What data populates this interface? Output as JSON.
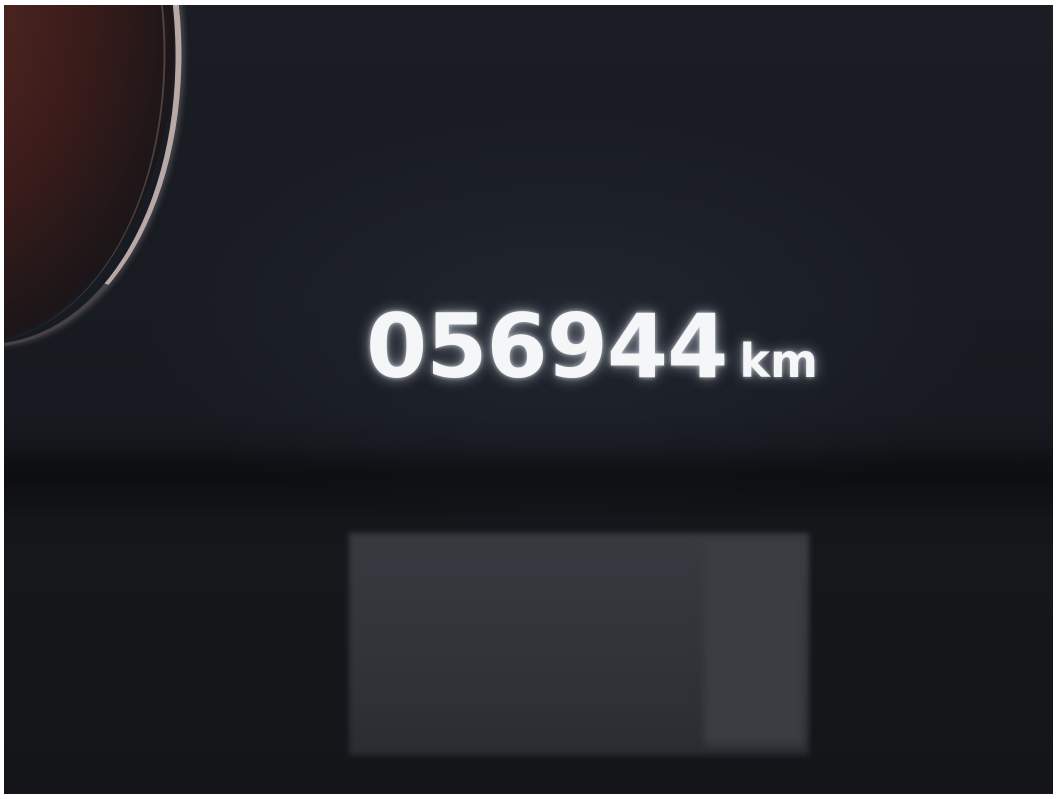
{
  "odometer": {
    "value": "056944",
    "unit": "km"
  },
  "colors": {
    "display_text": "#f4f6f8",
    "dashboard_background": "#171a20",
    "gauge_ring": "#b9a9a6"
  }
}
